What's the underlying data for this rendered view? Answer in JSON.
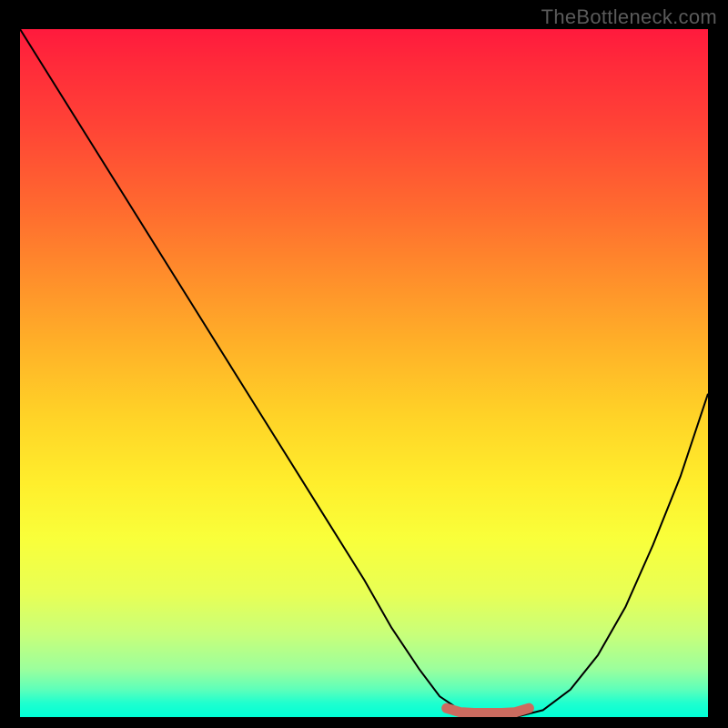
{
  "attribution": "TheBottleneck.com",
  "chart_data": {
    "type": "line",
    "title": "",
    "xlabel": "",
    "ylabel": "",
    "xlim": [
      0,
      100
    ],
    "ylim": [
      0,
      100
    ],
    "background_gradient": {
      "top_color": "#ff1a3d",
      "bottom_color": "#00ffd6",
      "meaning": "red (high/bad) to green (low/good)"
    },
    "series": [
      {
        "name": "bottleneck-curve",
        "color": "#000000",
        "x": [
          0,
          5,
          10,
          15,
          20,
          25,
          30,
          35,
          40,
          45,
          50,
          54,
          58,
          61,
          64,
          68,
          72,
          76,
          80,
          84,
          88,
          92,
          96,
          100
        ],
        "values": [
          100,
          92,
          84,
          76,
          68,
          60,
          52,
          44,
          36,
          28,
          20,
          13,
          7,
          3,
          1,
          0,
          0,
          1,
          4,
          9,
          16,
          25,
          35,
          47
        ]
      },
      {
        "name": "optimal-marker",
        "color": "#cc6b5f",
        "x": [
          62,
          64,
          66,
          68,
          70,
          72,
          74
        ],
        "values": [
          1.3,
          0.7,
          0.6,
          0.6,
          0.6,
          0.7,
          1.3
        ]
      }
    ],
    "optimal_range": {
      "start": 62,
      "end": 74
    }
  }
}
